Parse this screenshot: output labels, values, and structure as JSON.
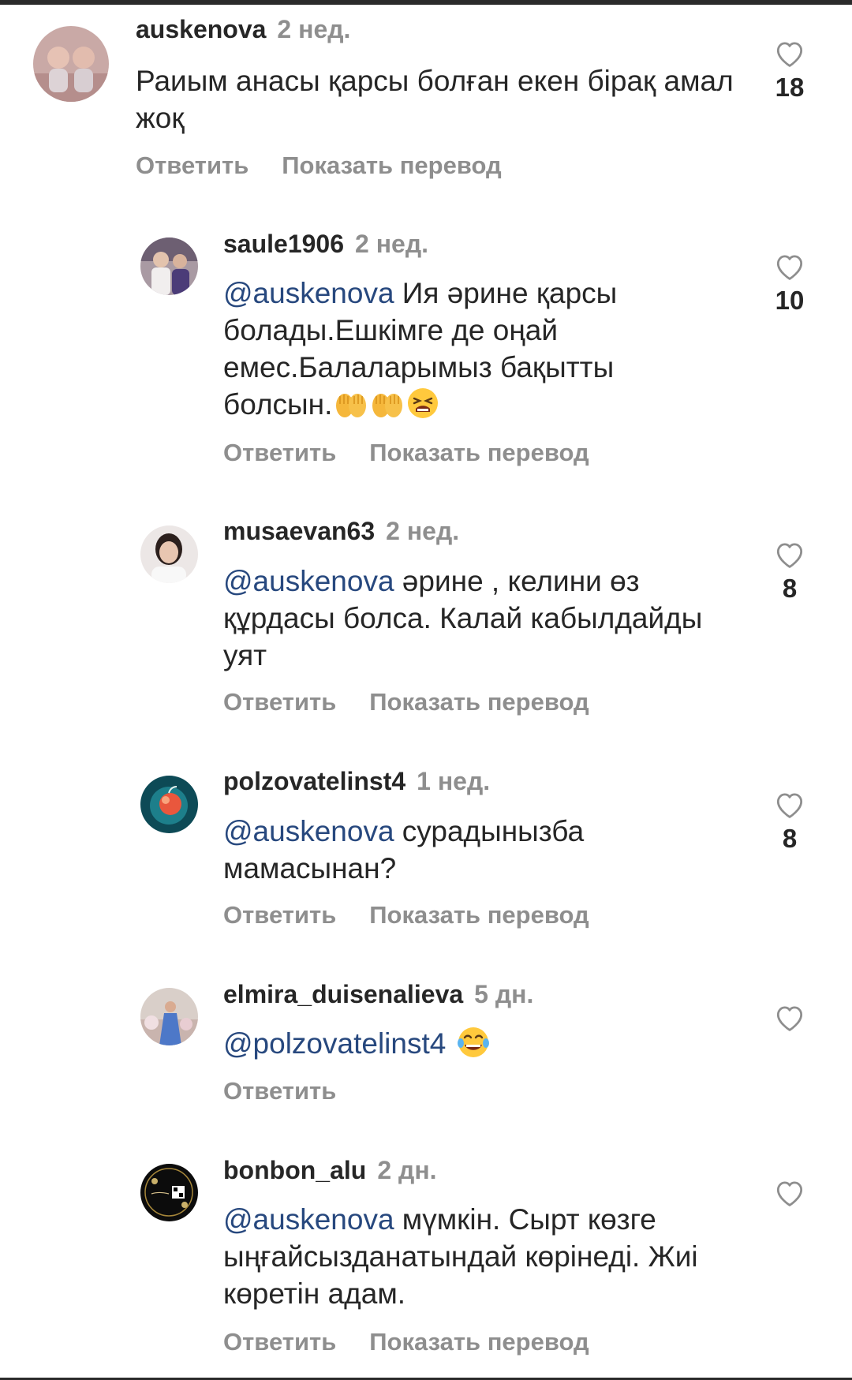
{
  "labels": {
    "reply": "Ответить",
    "translate": "Показать перевод"
  },
  "colors": {
    "mention": "#27487e",
    "muted": "#8e8e8e",
    "text": "#262626"
  },
  "comments": [
    {
      "username": "auskenova",
      "time": "2 нед.",
      "mention": "",
      "text": "Раиым анасы қарсы болған екен бірақ амал жоқ",
      "likes": "18",
      "emojis": [],
      "avatar_icon": "twin-babies-photo-avatar"
    },
    {
      "username": "saule1906",
      "time": "2 нед.",
      "mention": "@auskenova",
      "text": " Ия әрине қарсы болады.Ешкімге де оңай емес.Балаларымыз бақытты болсын.",
      "likes": "10",
      "emojis": [
        "palms-up-together-emoji",
        "palms-up-together-emoji",
        "tired-face-emoji"
      ],
      "avatar_icon": "two-women-photo-avatar"
    },
    {
      "username": "musaevan63",
      "time": "2 нед.",
      "mention": "@auskenova",
      "text": " әрине , келини өз құрдасы болса. Калай кабылдайды  уят",
      "likes": "8",
      "emojis": [],
      "avatar_icon": "woman-portrait-avatar"
    },
    {
      "username": "polzovatelinst4",
      "time": "1 нед.",
      "mention": "@auskenova",
      "text": " сурадынызба мамасынан?",
      "likes": "8",
      "emojis": [],
      "avatar_icon": "apple-art-avatar"
    },
    {
      "username": "elmira_duisenalieva",
      "time": "5 дн.",
      "mention": "@polzovatelinst4",
      "text": " ",
      "likes": "",
      "emojis": [
        "tears-of-joy-emoji"
      ],
      "avatar_icon": "woman-blue-dress-avatar"
    },
    {
      "username": "bonbon_alu",
      "time": "2 дн.",
      "mention": "@auskenova",
      "text": " мүмкін.  Сырт көзге ыңғайсызданатындай көрінеді. Жиі көретін адам.",
      "likes": "",
      "emojis": [],
      "avatar_icon": "black-logo-qr-avatar"
    }
  ]
}
